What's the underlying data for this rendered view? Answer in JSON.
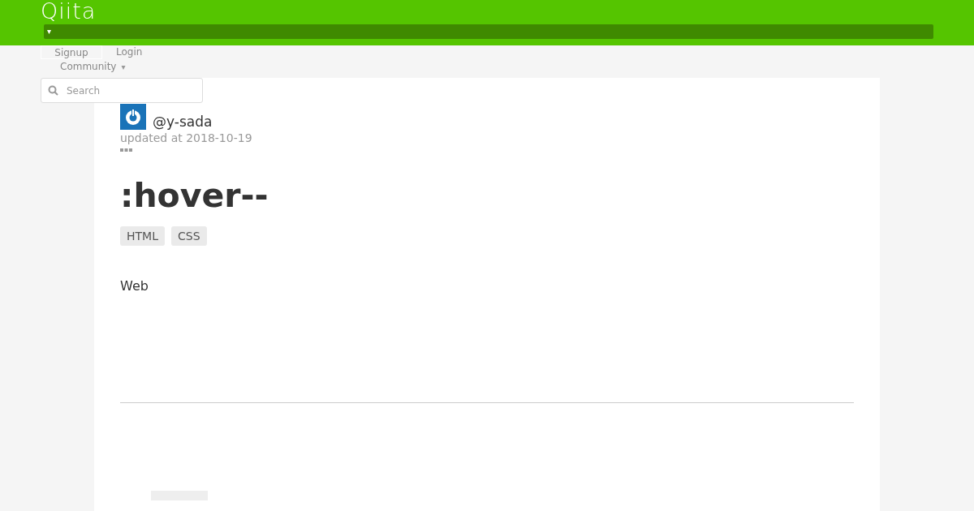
{
  "header": {
    "logo": "Qiita",
    "menu_caret": "▾"
  },
  "nav": {
    "signup": "Signup",
    "login": "Login",
    "community": "Community",
    "community_caret": "▾"
  },
  "search": {
    "placeholder": "Search"
  },
  "article": {
    "author": "@y-sada",
    "updated": "updated at 2018-10-19",
    "title": ":hover--",
    "tags": [
      "HTML",
      "CSS"
    ],
    "body": "Web"
  }
}
